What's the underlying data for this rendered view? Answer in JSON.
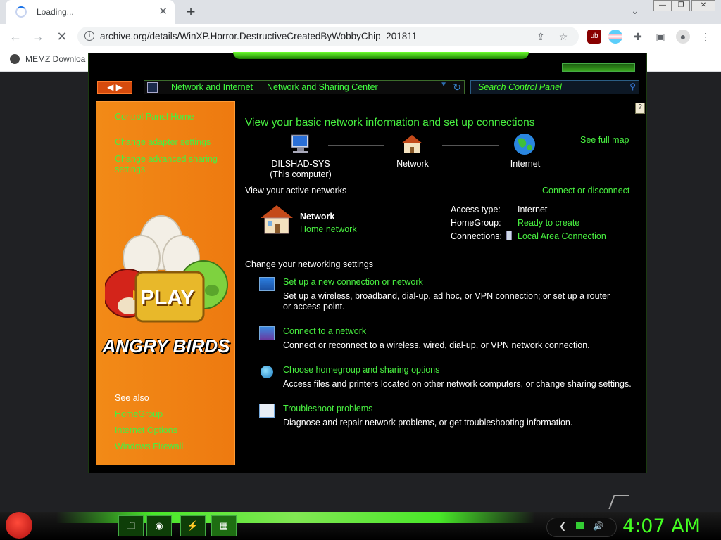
{
  "browser": {
    "tab_title": "Loading...",
    "tab_close": "✕",
    "new_tab": "+",
    "url": "archive.org/details/WinXP.Horror.DestructiveCreatedByWobbyChip_201811",
    "bookmark": "MEMZ Downloa",
    "window_controls": [
      "—",
      "❐",
      "✕"
    ]
  },
  "window": {
    "breadcrumb": [
      "Network and Internet",
      "Network and Sharing Center"
    ],
    "search_placeholder": "Search Control Panel",
    "help_icon": "?"
  },
  "sidebar": {
    "home": "Control Panel Home",
    "links": [
      "Change adapter settings",
      "Change advanced sharing settings"
    ],
    "see_also_label": "See also",
    "see_also": [
      "HomeGroup",
      "Internet Options",
      "Windows Firewall"
    ],
    "banner_play": "PLAY",
    "banner_title": "ANGRY BIRDS"
  },
  "main": {
    "heading": "View your basic network information and set up connections",
    "see_full_map": "See full map",
    "map_nodes": [
      {
        "label": "DILSHAD-SYS",
        "sub": "(This computer)"
      },
      {
        "label": "Network",
        "sub": ""
      },
      {
        "label": "Internet",
        "sub": ""
      }
    ],
    "active_networks_label": "View your active networks",
    "connect_disconnect": "Connect or disconnect",
    "network_name": "Network",
    "network_type": "Home network",
    "props": [
      {
        "key": "Access type:",
        "val": "Internet"
      },
      {
        "key": "HomeGroup:",
        "val": "Ready to create"
      },
      {
        "key": "Connections:",
        "val": "Local Area Connection"
      }
    ],
    "change_settings_label": "Change your networking settings",
    "tasks": [
      {
        "title": "Set up a new connection or network",
        "desc": "Set up a wireless, broadband, dial-up, ad hoc, or VPN connection; or set up a router or access point."
      },
      {
        "title": "Connect to a network",
        "desc": "Connect or reconnect to a wireless, wired, dial-up, or VPN network connection."
      },
      {
        "title": "Choose homegroup and sharing options",
        "desc": "Access files and printers located on other network computers, or change sharing settings."
      },
      {
        "title": "Troubleshoot problems",
        "desc": "Diagnose and repair network problems, or get troubleshooting information."
      }
    ]
  },
  "taskbar": {
    "clock": "4:07 AM"
  },
  "colors": {
    "accent_green": "#48f040",
    "sidebar_orange": "#f28a17",
    "background": "#000000"
  }
}
